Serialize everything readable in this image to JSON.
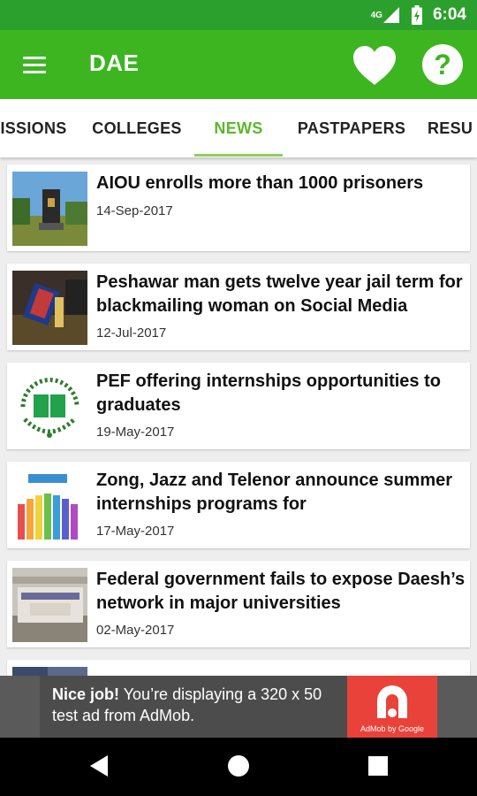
{
  "status_bar": {
    "network": "4G",
    "time": "6:04"
  },
  "app_bar": {
    "title": "DAE",
    "icons": [
      "menu-icon",
      "heart-icon",
      "help-icon"
    ]
  },
  "tabs": {
    "items": [
      {
        "label": "ISSIONS"
      },
      {
        "label": "COLLEGES"
      },
      {
        "label": "NEWS"
      },
      {
        "label": "PASTPAPERS"
      },
      {
        "label": "RESU"
      }
    ],
    "active": "NEWS"
  },
  "news": {
    "items": [
      {
        "title": "AIOU enrolls more than 1000 prisoners",
        "date": "14-Sep-2017"
      },
      {
        "title": "Peshawar man gets twelve year jail term for blackmailing woman on Social Media",
        "date": "12-Jul-2017"
      },
      {
        "title": "PEF offering internships opportunities to graduates",
        "date": "19-May-2017"
      },
      {
        "title": "Zong, Jazz and Telenor announce summer internships programs for",
        "date": "17-May-2017"
      },
      {
        "title": "Federal government fails to expose Daesh’s network in major universities",
        "date": "02-May-2017"
      }
    ]
  },
  "ad": {
    "headline_bold": "Nice job!",
    "headline_rest": " You’re displaying a 320 x 50 test ad from AdMob.",
    "brand": "AdMob by Google"
  },
  "nav_bar": {
    "icons": [
      "back-icon",
      "home-icon",
      "recents-icon"
    ]
  },
  "colors": {
    "status_bar": "#2ca02c",
    "app_bar": "#3cb521",
    "active_tab": "#5cb82c",
    "ad_logo": "#e9423a"
  }
}
